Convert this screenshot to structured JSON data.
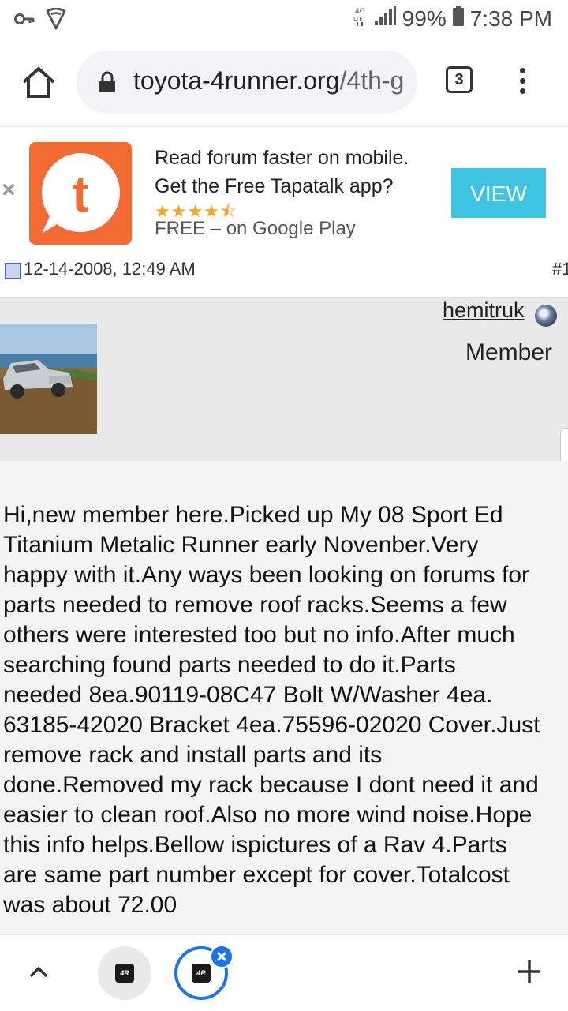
{
  "status_bar": {
    "network": "4G LTE",
    "battery": "99%",
    "time": "7:38 PM"
  },
  "browser": {
    "url_domain": "toyota-4runner.org",
    "url_path": "/4th-g",
    "tab_count": "3"
  },
  "banner": {
    "line1": "Read forum faster on mobile.",
    "line2": "Get the Free Tapatalk app?",
    "stars": "★★★★⯪",
    "rating_stars": 4.5,
    "line3": "FREE – on Google Play",
    "view_label": "VIEW",
    "close_glyph": "×",
    "logo_letter": "t"
  },
  "post": {
    "date": "12-14-2008, 12:49 AM",
    "number": "#1",
    "username": "hemitruk",
    "user_title": "Member",
    "body": "Hi,new member here.Picked up My 08 Sport Ed\nTitanium Metalic Runner early Novenber.Very\nhappy with it.Any ways been looking on forums for\nparts needed to remove roof racks.Seems a few\nothers were interested too but no info.After much\nsearching found parts needed to do it.Parts\nneeded 8ea.90119-08C47 Bolt W/Washer 4ea.\n63185-42020 Bracket 4ea.75596-02020 Cover.Just\nremove rack and install parts and its\ndone.Removed my rack because I dont need it and\neasier to clean roof.Also no more wind noise.Hope\nthis info helps.Bellow ispictures of a Rav 4.Parts\nare same part number except for cover.Totalcost\nwas about 72.00"
  },
  "bottom_bar": {
    "tab1_favicon": "4R",
    "tab2_favicon": "4R"
  },
  "colors": {
    "tapatalk_orange": "#f26b32",
    "view_button": "#3ec3e3",
    "active_tab_ring": "#1a73e8"
  }
}
